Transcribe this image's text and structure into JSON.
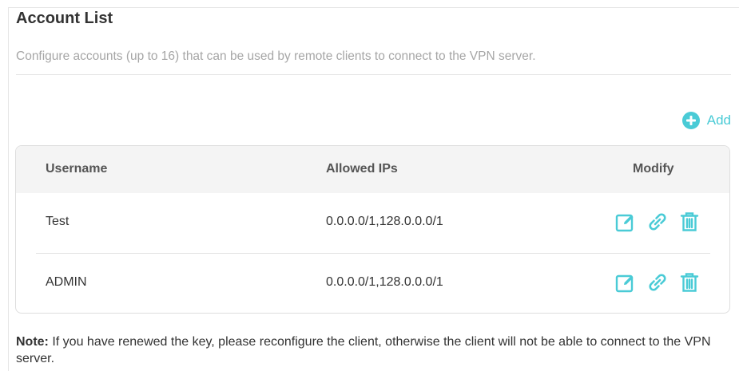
{
  "section": {
    "title": "Account List",
    "description": "Configure accounts (up to 16) that can be used by remote clients to connect to the VPN server."
  },
  "add_button": {
    "label": "Add",
    "icon": "plus-circle-icon"
  },
  "table": {
    "columns": [
      "Username",
      "Allowed IPs",
      "Modify"
    ],
    "rows": [
      {
        "username": "Test",
        "allowed_ips": "0.0.0.0/1,128.0.0.0/1"
      },
      {
        "username": "ADMIN",
        "allowed_ips": "0.0.0.0/1,128.0.0.0/1"
      }
    ],
    "row_actions": [
      "edit-icon",
      "link-icon",
      "trash-icon"
    ]
  },
  "note": {
    "label": "Note:",
    "text": " If you have renewed the key, please reconfigure the client, otherwise the client will not be able to connect to the VPN server."
  },
  "colors": {
    "accent": "#4acbd6",
    "title": "#333333",
    "muted": "#a6a6a6",
    "header_bg": "#f4f4f4"
  }
}
